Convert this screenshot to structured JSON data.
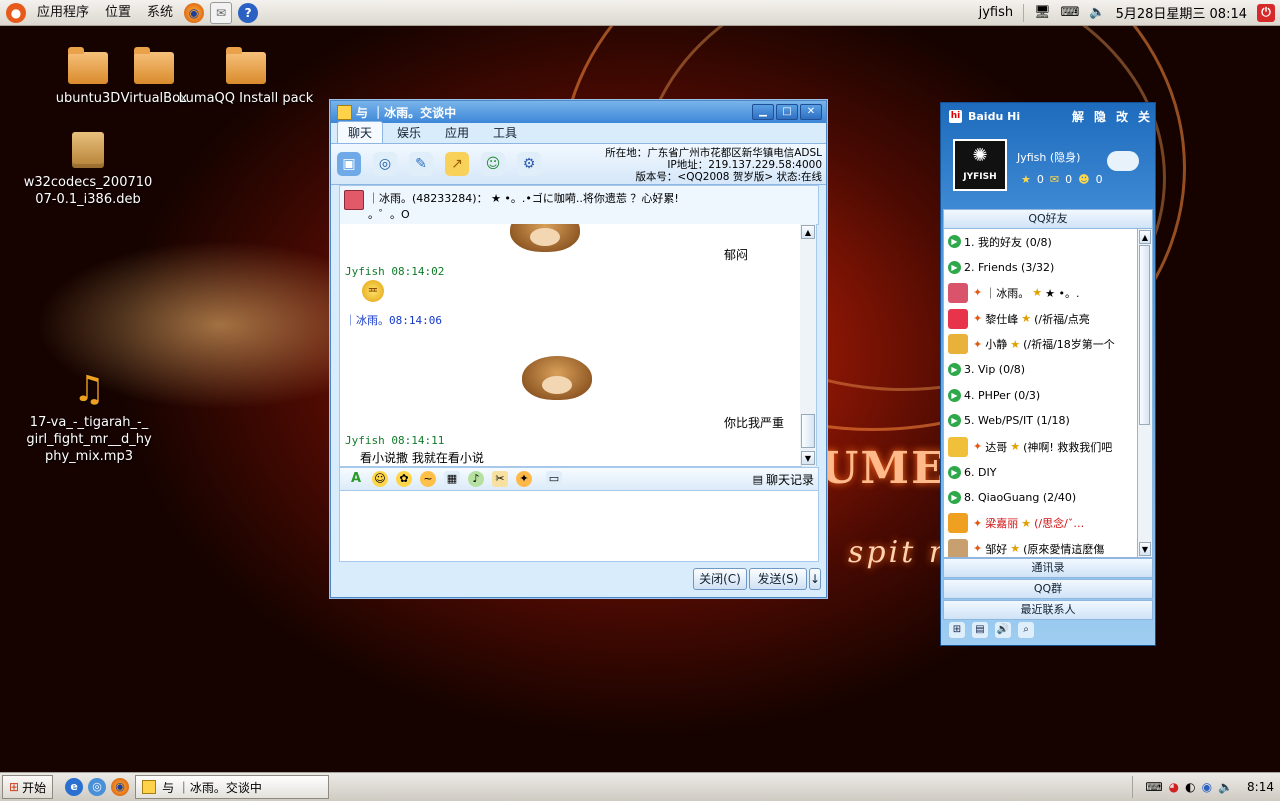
{
  "top_panel": {
    "menus": [
      "应用程序",
      "位置",
      "系统"
    ],
    "user": "jyfish",
    "datetime": "5月28日星期三 08:14"
  },
  "desktop": {
    "icons": [
      {
        "label": "ubuntu3D",
        "icon": "folder-icon"
      },
      {
        "label": "VirtualBox",
        "icon": "folder-icon"
      },
      {
        "label": "LumaQQ Install pack",
        "icon": "folder-icon"
      },
      {
        "label": "w32codecs_20071007-0.1_i386.deb",
        "icon": "package-icon"
      },
      {
        "label": "17-va_-_tigarah_-_girl_fight_mr__d_hyphy_mix.mp3",
        "icon": "music-icon"
      }
    ]
  },
  "chat": {
    "title": "与 ｜冰雨。交谈中",
    "tabs": [
      "聊天",
      "娱乐",
      "应用",
      "工具"
    ],
    "info": {
      "location": "所在地：广东省广州市花都区新华镇电信ADSL",
      "ip": "IP地址：219.137.229.58:4000",
      "version": "版本号：<QQ2008 贺岁版>  状态:在线"
    },
    "contact": {
      "name_line": "｜冰雨。(48233284)：  ★ •。.•ゴに咖嗬..将你遗莣  ？心好累!",
      "signature_tail": "。゜。O"
    },
    "messages": {
      "m1_text": "郁闷",
      "m2_sender": "Jyfish 08:14:02",
      "m3_sender": "｜冰雨。08:14:06",
      "m3_text": "你比我严重",
      "m4_sender": "Jyfish 08:14:11",
      "m4_text": "看小说撒 我就在看小说"
    },
    "history_label": "聊天记录",
    "close_label": "关闭(C)",
    "send_label": "发送(S)"
  },
  "baidu_hi": {
    "title": "Baidu Hi",
    "controls": [
      "解",
      "隐",
      "改",
      "关"
    ],
    "user": "Jyfish (隐身)",
    "avatar_text": "JYFISH",
    "stats": [
      "0",
      "0",
      "0"
    ],
    "tab_header": "QQ好友",
    "rows": [
      {
        "kind": "group",
        "text": "1. 我的好友 (0/8)"
      },
      {
        "kind": "group",
        "text": "2. Friends (3/32)"
      },
      {
        "kind": "buddy",
        "name": "｜冰雨。",
        "status": "★ •。.",
        "color": "#000000",
        "avatar": "#d9536a"
      },
      {
        "kind": "buddy",
        "name": "黎仕峰",
        "status": "(/祈福/点亮",
        "color": "#000000",
        "avatar": "#e8344a"
      },
      {
        "kind": "buddy",
        "name": "小静",
        "status": "(/祈福/18岁第一个",
        "color": "#000000",
        "avatar": "#e8b23a"
      },
      {
        "kind": "group",
        "text": "3. Vip (0/8)"
      },
      {
        "kind": "group",
        "text": "4. PHPer (0/3)"
      },
      {
        "kind": "group",
        "text": "5. Web/PS/IT (1/18)"
      },
      {
        "kind": "buddy",
        "name": "达哥",
        "status": "(神啊! 救救我们吧",
        "color": "#000000",
        "avatar": "#f0c03a"
      },
      {
        "kind": "group",
        "text": "6. DIY"
      },
      {
        "kind": "group",
        "text": "8. QiaoGuang (2/40)"
      },
      {
        "kind": "buddy",
        "name": "梁嘉丽",
        "status": "(/思念/ˇ…",
        "color": "#d01010",
        "avatar": "#f0a020"
      },
      {
        "kind": "buddy",
        "name": "邹好",
        "status": "(原來愛情這麼傷",
        "color": "#000000",
        "avatar": "#c8a070"
      }
    ],
    "bottom_tabs": [
      "通讯录",
      "QQ群",
      "最近联系人"
    ]
  },
  "taskbar": {
    "start_label": "开始",
    "task_label": "与 ｜冰雨。交谈中",
    "clock": "8:14"
  },
  "wallpaper": {
    "text1": "UME S",
    "text2": "spit nto"
  }
}
